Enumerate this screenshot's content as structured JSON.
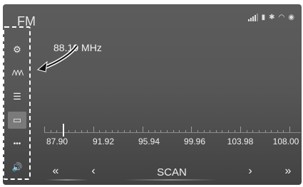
{
  "header": {
    "source_title": "FM"
  },
  "status_icons": [
    "signal-bars-icon",
    "phone-battery-icon",
    "bluetooth-icon",
    "wifi-icon",
    "gps-icon"
  ],
  "sidebar": {
    "items": [
      {
        "name": "source-select-icon",
        "glyph": "⚙"
      },
      {
        "name": "station-list-icon",
        "glyph": "ᐱᐱᐱ"
      },
      {
        "name": "presets-list-icon",
        "glyph": "☰"
      },
      {
        "name": "tuner-view-icon",
        "glyph": "▭"
      },
      {
        "name": "more-icon",
        "glyph": "•••"
      },
      {
        "name": "volume-icon",
        "glyph": "🔊"
      }
    ],
    "selected_index": 3
  },
  "tuner": {
    "frequency_value": "88.10",
    "frequency_unit": "MHz",
    "scale_labels": [
      "87.90",
      "91.92",
      "95.94",
      "99.96",
      "103.98",
      "108.00"
    ]
  },
  "controls": {
    "seek_back": "«",
    "step_back": "‹",
    "scan_label": "SCAN",
    "step_forward": "›",
    "seek_forward": "»"
  }
}
